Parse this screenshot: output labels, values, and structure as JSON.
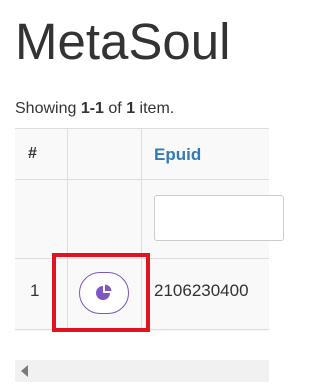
{
  "page": {
    "title": "MetaSoul"
  },
  "summary": {
    "prefix": "Showing ",
    "range": "1-1",
    "middle": " of ",
    "total": "1",
    "suffix": " item."
  },
  "table": {
    "columns": {
      "num": "#",
      "epuid": "Epuid"
    },
    "filter": {
      "epuid_value": ""
    },
    "rows": [
      {
        "num": "1",
        "action_icon": "pie-chart-icon",
        "epuid": "2106230400"
      }
    ]
  },
  "colors": {
    "link": "#337ab7",
    "action_accent": "#7e57c2",
    "highlight": "#e0141e"
  }
}
